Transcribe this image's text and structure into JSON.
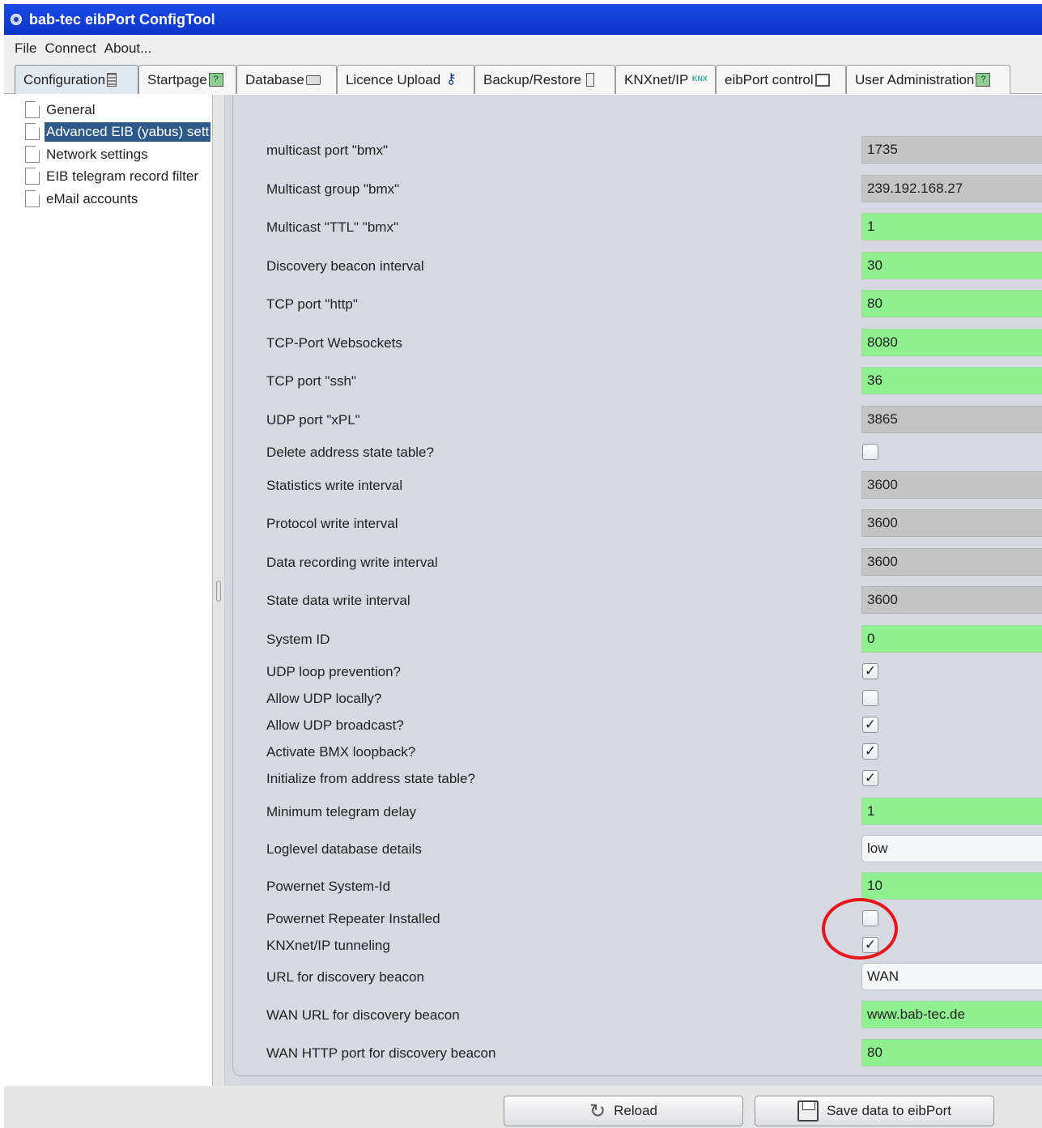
{
  "window": {
    "title": "bab-tec eibPort ConfigTool",
    "icon": "app-logo-icon"
  },
  "menu": [
    "File",
    "Connect",
    "About..."
  ],
  "tabs": [
    {
      "label": "Configuration",
      "icon": "config-icon",
      "active": true
    },
    {
      "label": "Startpage",
      "icon": "help-icon"
    },
    {
      "label": "Database",
      "icon": "database-icon"
    },
    {
      "label": "Licence Upload",
      "icon": "key-icon"
    },
    {
      "label": "Backup/Restore",
      "icon": "file-icon"
    },
    {
      "label": "KNXnet/IP",
      "icon": "knx-icon"
    },
    {
      "label": "eibPort control",
      "icon": "monitor-icon"
    },
    {
      "label": "User Administration",
      "icon": "help-icon"
    }
  ],
  "tab_icon_text": {
    "help": "?",
    "knx": "KNX"
  },
  "sidebar": {
    "items": [
      {
        "label": "General"
      },
      {
        "label": "Advanced EIB (yabus) sett",
        "selected": true
      },
      {
        "label": "Network settings"
      },
      {
        "label": "EIB telegram record filter"
      },
      {
        "label": "eMail accounts"
      }
    ]
  },
  "settings": [
    {
      "label": "multicast port \"bmx\"",
      "type": "field",
      "style": "gray",
      "value": "1735"
    },
    {
      "label": "Multicast group \"bmx\"",
      "type": "field",
      "style": "gray",
      "value": "239.192.168.27"
    },
    {
      "label": "Multicast \"TTL\" \"bmx\"",
      "type": "field",
      "style": "green",
      "value": "1"
    },
    {
      "label": "Discovery beacon interval",
      "type": "field",
      "style": "green",
      "value": "30"
    },
    {
      "label": "TCP port \"http\"",
      "type": "field",
      "style": "green",
      "value": "80"
    },
    {
      "label": "TCP-Port Websockets",
      "type": "field",
      "style": "green",
      "value": "8080"
    },
    {
      "label": "TCP port \"ssh\"",
      "type": "field",
      "style": "green",
      "value": "36"
    },
    {
      "label": "UDP port \"xPL\"",
      "type": "field",
      "style": "gray",
      "value": "3865"
    },
    {
      "label": "Delete address state table?",
      "type": "checkbox",
      "checked": false
    },
    {
      "label": "Statistics write interval",
      "type": "field",
      "style": "gray",
      "value": "3600"
    },
    {
      "label": "Protocol write interval",
      "type": "field",
      "style": "gray",
      "value": "3600"
    },
    {
      "label": "Data recording write interval",
      "type": "field",
      "style": "gray",
      "value": "3600"
    },
    {
      "label": "State data write interval",
      "type": "field",
      "style": "gray",
      "value": "3600"
    },
    {
      "label": "System ID",
      "type": "field",
      "style": "green",
      "value": "0"
    },
    {
      "label": "UDP loop prevention?",
      "type": "checkbox",
      "checked": true
    },
    {
      "label": "Allow UDP locally?",
      "type": "checkbox",
      "checked": false
    },
    {
      "label": "Allow UDP broadcast?",
      "type": "checkbox",
      "checked": true
    },
    {
      "label": "Activate BMX loopback?",
      "type": "checkbox",
      "checked": true
    },
    {
      "label": "Initialize from address state table?",
      "type": "checkbox",
      "checked": true
    },
    {
      "label": "Minimum telegram delay",
      "type": "field",
      "style": "green",
      "value": "1"
    },
    {
      "label": "Loglevel database details",
      "type": "select",
      "value": "low"
    },
    {
      "label": "Powernet System-Id",
      "type": "field",
      "style": "green",
      "value": "10"
    },
    {
      "label": "Powernet Repeater Installed",
      "type": "checkbox",
      "checked": false
    },
    {
      "label": "KNXnet/IP tunneling",
      "type": "checkbox",
      "checked": true
    },
    {
      "label": "URL for discovery beacon",
      "type": "select",
      "value": "WAN"
    },
    {
      "label": "WAN URL for discovery beacon",
      "type": "field",
      "style": "green",
      "value": "www.bab-tec.de"
    },
    {
      "label": "WAN HTTP port for discovery beacon",
      "type": "field",
      "style": "green",
      "value": "80"
    }
  ],
  "colors": {
    "field_green": "#8ff08f",
    "field_gray": "#c4c4c4",
    "titlebar": "#0a34c9",
    "highlight": "#e8161b",
    "selection": "#2e5a8a"
  },
  "buttons": {
    "reload": {
      "label": "Reload",
      "icon": "reload-icon"
    },
    "save": {
      "label": "Save data to eibPort",
      "icon": "floppy-disk-icon"
    }
  },
  "checkmark": "✓"
}
